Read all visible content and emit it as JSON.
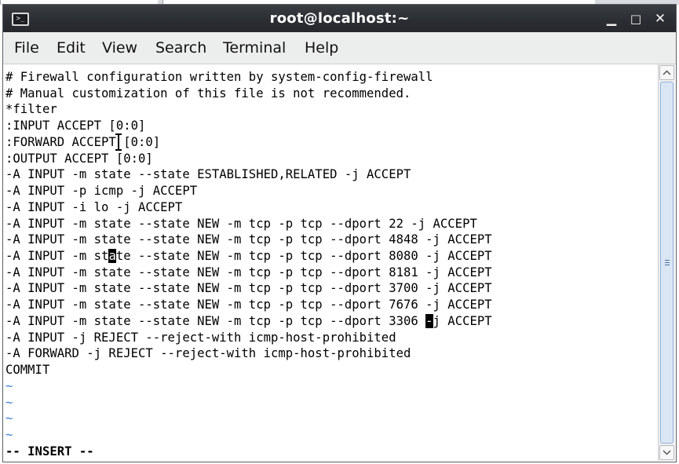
{
  "window": {
    "title": "root@localhost:~",
    "icon": "terminal-icon",
    "controls": {
      "minimize": "minimize-icon",
      "maximize": "maximize-icon",
      "close": "close-icon"
    }
  },
  "menu": [
    "File",
    "Edit",
    "View",
    "Search",
    "Terminal",
    "Help"
  ],
  "editor": {
    "lines": [
      "# Firewall configuration written by system-config-firewall",
      "# Manual customization of this file is not recommended.",
      "*filter",
      ":INPUT ACCEPT [0:0]",
      ":FORWARD ACCEPT [0:0]",
      ":OUTPUT ACCEPT [0:0]",
      "-A INPUT -m state --state ESTABLISHED,RELATED -j ACCEPT",
      "-A INPUT -p icmp -j ACCEPT",
      "-A INPUT -i lo -j ACCEPT",
      "-A INPUT -m state --state NEW -m tcp -p tcp --dport 22 -j ACCEPT",
      "-A INPUT -m state --state NEW -m tcp -p tcp --dport 4848 -j ACCEPT",
      "-A INPUT -m state --state NEW -m tcp -p tcp --dport 8080 -j ACCEPT",
      "-A INPUT -m state --state NEW -m tcp -p tcp --dport 8181 -j ACCEPT",
      "-A INPUT -m state --state NEW -m tcp -p tcp --dport 3700 -j ACCEPT",
      "-A INPUT -m state --state NEW -m tcp -p tcp --dport 7676 -j ACCEPT",
      "-A INPUT -m state --state NEW -m tcp -p tcp --dport 3306 -j ACCEPT",
      "-A INPUT -j REJECT --reject-with icmp-host-prohibited",
      "-A FORWARD -j REJECT --reject-with icmp-host-prohibited",
      "COMMIT"
    ],
    "tildes": [
      "~",
      "~",
      "~",
      "~"
    ],
    "highlight": {
      "line": 11,
      "col": 14,
      "char": "a"
    },
    "cursor": {
      "line": 15,
      "col": 57
    },
    "status": "-- INSERT --"
  },
  "colors": {
    "titlebar": "#2b2e33",
    "menubar": "#eceded",
    "tilde": "#3a7fd9",
    "scroll_thumb": "#dbe6f5"
  }
}
